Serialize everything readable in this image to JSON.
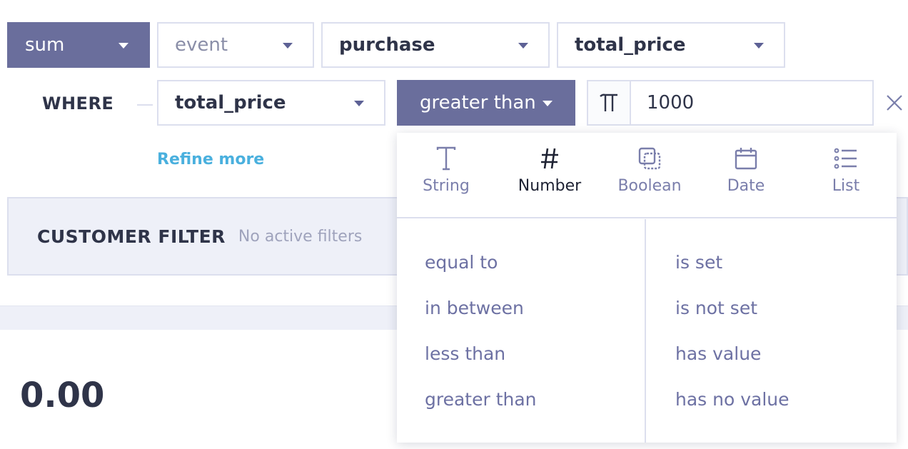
{
  "query": {
    "aggregate": "sum",
    "source": "event",
    "event_name": "purchase",
    "property": "total_price"
  },
  "where": {
    "label": "WHERE",
    "property": "total_price",
    "operator": "greater than",
    "value": "1000"
  },
  "refine_more": "Refine more",
  "customer_filter": {
    "title": "CUSTOMER FILTER",
    "status": "No active filters"
  },
  "result": "0.00",
  "type_tabs": [
    "String",
    "Number",
    "Boolean",
    "Date",
    "List"
  ],
  "active_type": "Number",
  "operators_left": [
    "equal to",
    "in between",
    "less than",
    "greater than"
  ],
  "operators_right": [
    "is set",
    "is not set",
    "has value",
    "has no value"
  ],
  "colors": {
    "primary": "#6a6e9c",
    "link": "#4ab0de",
    "text": "#2f3449",
    "muted_option": "#6d71a3",
    "border": "#dcdfee"
  },
  "icons": {
    "string": "text-t-icon",
    "number": "hash-icon",
    "boolean": "boolean-icon",
    "date": "calendar-icon",
    "list": "list-icon",
    "value_type": "pi-icon",
    "remove": "close-icon"
  }
}
